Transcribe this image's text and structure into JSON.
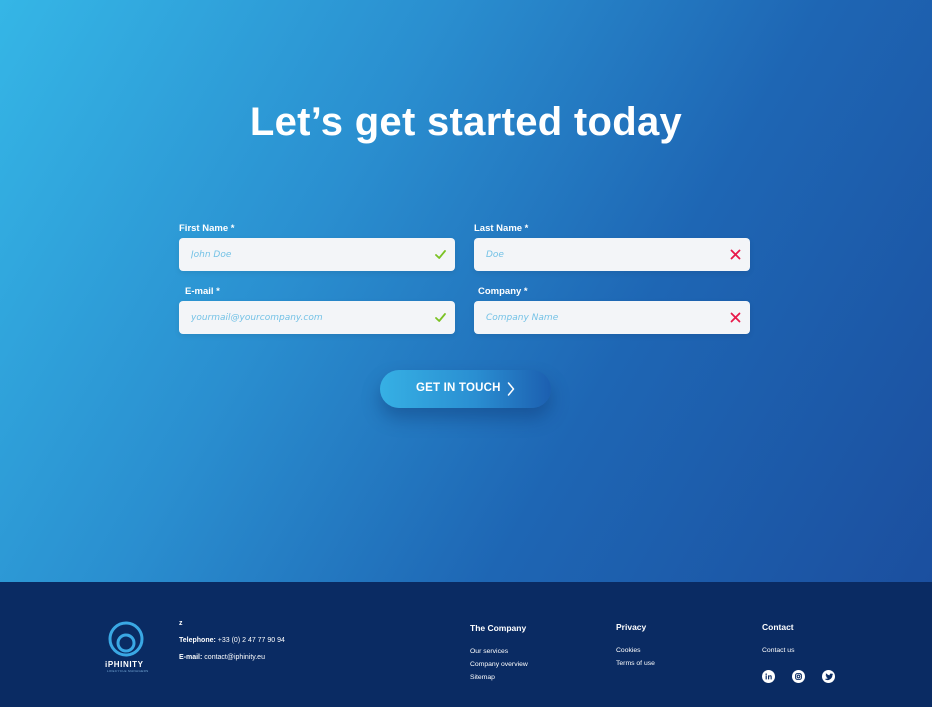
{
  "hero": {
    "title": "Let’s get started today"
  },
  "form": {
    "first_name": {
      "label": "First Name *",
      "placeholder": "John Doe",
      "status": "valid"
    },
    "last_name": {
      "label": "Last Name *",
      "placeholder": "Doe",
      "status": "invalid"
    },
    "email": {
      "label": "E-mail *",
      "placeholder": "yourmail@yourcompany.com",
      "status": "valid"
    },
    "company": {
      "label": "Company *",
      "placeholder": "Company Name",
      "status": "invalid"
    },
    "submit_label": "GET IN TOUCH"
  },
  "colors": {
    "valid": "#7bc224",
    "invalid": "#e8194a",
    "footer_bg": "#0a2b63"
  },
  "footer": {
    "logo_text": "iPHINITY",
    "logo_sub": "LIFECYCLE MANAGERS",
    "address_marker": "z",
    "telephone_label": "Telephone:",
    "telephone_value": "+33 (0) 2 47 77 90 94",
    "email_label": "E-mail:",
    "email_value": "contact@iphinity.eu",
    "company": {
      "heading": "The Company",
      "links": [
        "Our services",
        "Company overview",
        "Sitemap"
      ]
    },
    "privacy": {
      "heading": "Privacy",
      "links": [
        "Cookies",
        "Terms of use"
      ]
    },
    "contact": {
      "heading": "Contact",
      "links": [
        "Contact us"
      ]
    },
    "social_icons": [
      "linkedin-icon",
      "instagram-icon",
      "twitter-icon"
    ]
  }
}
